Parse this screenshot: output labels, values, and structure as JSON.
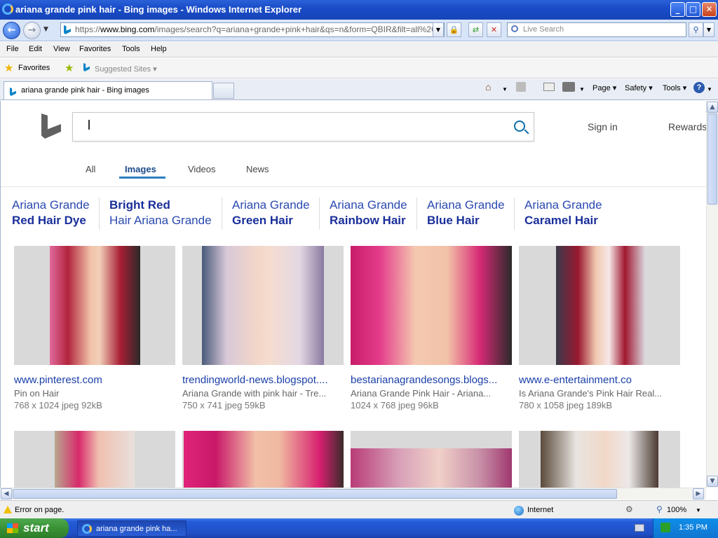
{
  "window": {
    "title": "ariana grande pink hair - Bing images - Windows Internet Explorer",
    "minimize": "_",
    "maximize": "□",
    "close": "✕"
  },
  "address": {
    "prefix": "https://",
    "host": "www.bing.com",
    "path": "/images/search?q=ariana+grande+pink+hair&qs=n&form=QBIR&filt=all%2Call%2",
    "search_placeholder": "Live Search"
  },
  "menu": [
    "File",
    "Edit",
    "View",
    "Favorites",
    "Tools",
    "Help"
  ],
  "favorites": {
    "label": "Favorites",
    "suggested": "Suggested Sites ▾"
  },
  "tab": {
    "title": "ariana grande pink hair - Bing images"
  },
  "commandbar": {
    "page": "Page ▾",
    "safety": "Safety ▾",
    "tools": "Tools ▾"
  },
  "bing": {
    "search_value": "",
    "sign_in": "Sign in",
    "rewards": "Rewards",
    "nav": [
      "All",
      "Images",
      "Videos",
      "News"
    ],
    "active_nav": "Images",
    "related": [
      {
        "line1": "Ariana Grande",
        "line2": "Red Hair Dye",
        "bold_line": 2
      },
      {
        "line1": "Bright Red",
        "line2": "Hair Ariana Grande",
        "bold_line": 1
      },
      {
        "line1": "Ariana Grande",
        "line2": "Green Hair",
        "bold_line": 2
      },
      {
        "line1": "Ariana Grande",
        "line2": "Rainbow Hair",
        "bold_line": 2
      },
      {
        "line1": "Ariana Grande",
        "line2": "Blue Hair",
        "bold_line": 2
      },
      {
        "line1": "Ariana Grande",
        "line2": "Caramel Hair",
        "bold_line": 2
      }
    ],
    "results": [
      {
        "source": "www.pinterest.com",
        "desc": "Pin on Hair",
        "meta": "768 x 1024 jpeg 92kB"
      },
      {
        "source": "trendingworld-news.blogspot....",
        "desc": "Ariana Grande with pink hair - Tre...",
        "meta": "750 x 741 jpeg 59kB"
      },
      {
        "source": "bestarianagrandesongs.blogs...",
        "desc": "Ariana Grande Pink Hair - Ariana...",
        "meta": "1024 x 768 jpeg 96kB"
      },
      {
        "source": "www.e-entertainment.co",
        "desc": "Is Ariana Grande's Pink Hair Real...",
        "meta": "780 x 1058 jpeg 189kB"
      }
    ]
  },
  "status": {
    "left": "Error on page.",
    "zone": "Internet",
    "zoom": "100%"
  },
  "taskbar": {
    "start": "start",
    "item": "ariana grande pink ha...",
    "clock": "1:35 PM"
  },
  "colors": {
    "link": "#1a3fa8",
    "accent": "#2a7fc0",
    "title_bar": "#1a4cc8"
  }
}
